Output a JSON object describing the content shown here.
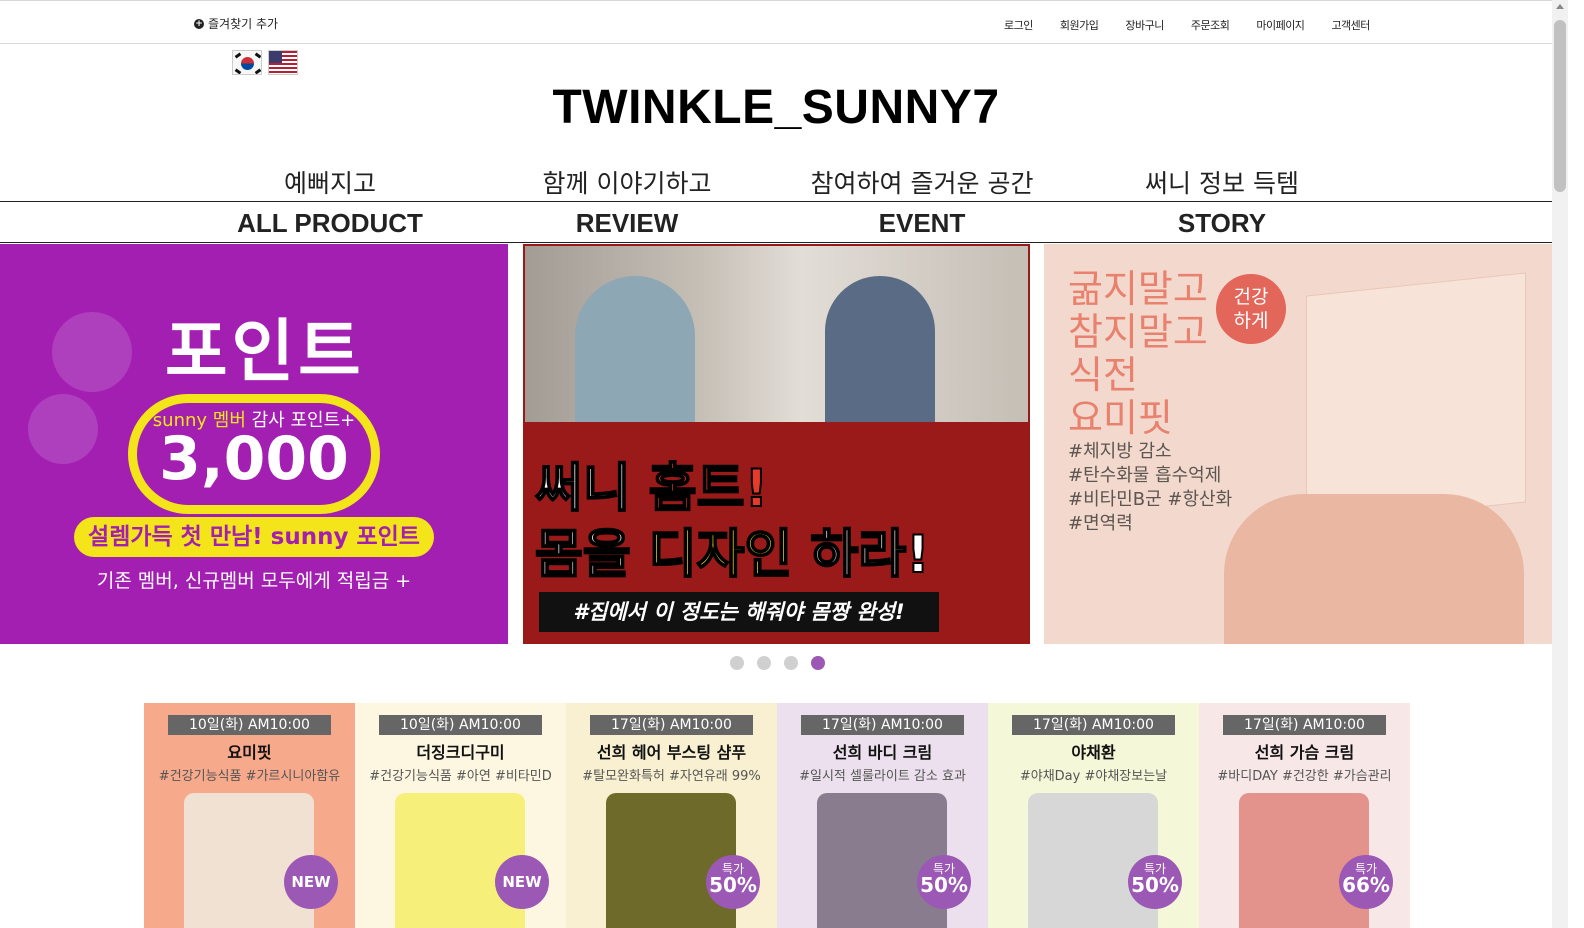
{
  "topbar": {
    "bookmark_label": "즐겨찾기 추가",
    "links": [
      "로그인",
      "회원가입",
      "장바구니",
      "주문조회",
      "마이페이지",
      "고객센터"
    ]
  },
  "logo": "TWINKLE_SUNNY7",
  "nav": {
    "korean": [
      "예뻐지고",
      "함께 이야기하고",
      "참여하여 즐거운 공간",
      "써니 정보 득템"
    ],
    "english": [
      "ALL PRODUCT",
      "REVIEW",
      "EVENT",
      "STORY"
    ]
  },
  "banners": {
    "point": {
      "title": "포인트",
      "subtitle_highlight": "sunny 멤버",
      "subtitle_rest": " 감사 포인트+",
      "amount": "3,000",
      "pill": "설렘가득 첫 만남! sunny 포인트",
      "note": "기존 멤버, 신규멤버 모두에게 적립금 +"
    },
    "hometraining": {
      "line1_a": "써니 ",
      "line1_b": "홈트!",
      "line2_a": "몸을 ",
      "line2_b": "디자인",
      "line2_c": " 하라!",
      "caption": "#집에서 이 정도는 해줘야 몸짱 완성!"
    },
    "yomifit": {
      "headline": [
        "굶지말고",
        "참지말고",
        "식전",
        "요미핏"
      ],
      "badge": [
        "건강",
        "하게"
      ],
      "tags": [
        "#체지방 감소",
        "#탄수화물 흡수억제",
        "#비타민B군 #항산화",
        "#면역력"
      ]
    }
  },
  "slider": {
    "count": 4,
    "active_index": 3
  },
  "products": [
    {
      "date": "10일(화) AM10:00",
      "name": "요미핏",
      "tags": "#건강기능식품 #가르시니아함유",
      "sticker_type": "new",
      "sticker": "NEW",
      "bg": "#f7a98c",
      "img": "#f1e1d3"
    },
    {
      "date": "10일(화) AM10:00",
      "name": "더징크디구미",
      "tags": "#건강기능식품 #아연 #비타민D",
      "sticker_type": "new",
      "sticker": "NEW",
      "bg": "#fdf7e1",
      "img": "#f6ef7a"
    },
    {
      "date": "17일(화) AM10:00",
      "name": "선희 헤어 부스팅 샴푸",
      "tags": "#탈모완화특허 #자연유래 99%",
      "sticker_type": "sale",
      "sticker_label": "특가",
      "sticker": "50%",
      "bg": "#f8f0d0",
      "img": "#6d6a2a"
    },
    {
      "date": "17일(화) AM10:00",
      "name": "선희 바디 크림",
      "tags": "#일시적 셀룰라이트 감소 효과",
      "sticker_type": "sale",
      "sticker_label": "특가",
      "sticker": "50%",
      "bg": "#ece0ee",
      "img": "#8a7c8f"
    },
    {
      "date": "17일(화) AM10:00",
      "name": "야채환",
      "tags": "#야채Day #야채장보는날",
      "sticker_type": "sale",
      "sticker_label": "특가",
      "sticker": "50%",
      "bg": "#f5f8d8",
      "img": "#d7d7d7"
    },
    {
      "date": "17일(화) AM10:00",
      "name": "선희 가슴 크림",
      "tags": "#바디DAY #건강한 #가슴관리",
      "sticker_type": "sale",
      "sticker_label": "특가",
      "sticker": "66%",
      "bg": "#f7e7e6",
      "img": "#e4928c"
    }
  ],
  "colors": {
    "accent_purple": "#9b58b4",
    "banner_purple": "#a21fb2",
    "banner_yellow": "#f4e41a"
  }
}
